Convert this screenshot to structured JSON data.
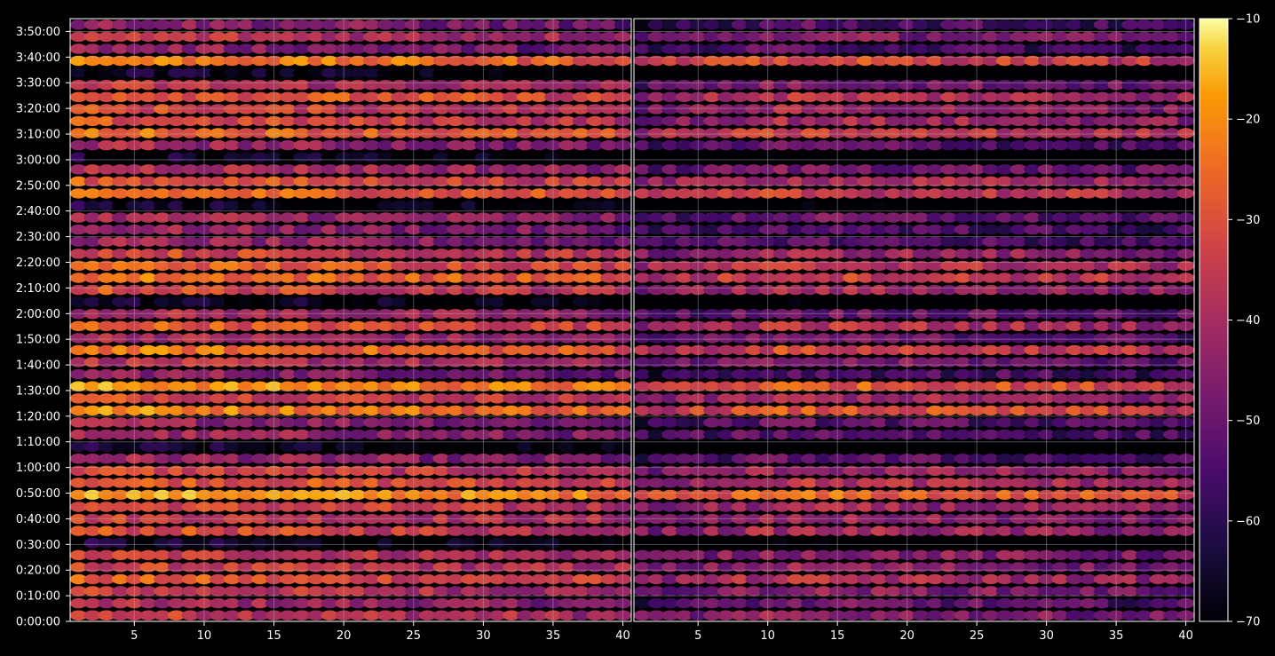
{
  "chart_data": [
    {
      "type": "heatmap",
      "title": "",
      "xlabel": "",
      "ylabel": "",
      "x_range": [
        1,
        40
      ],
      "y_range_seconds": [
        0,
        14100
      ],
      "x_ticks": [
        5,
        10,
        15,
        20,
        25,
        30,
        35,
        40
      ],
      "x_tick_labels": [
        "5",
        "10",
        "15",
        "20",
        "25",
        "30",
        "35",
        "40"
      ],
      "y_ticks_seconds": [
        0,
        600,
        1200,
        1800,
        2400,
        3000,
        3600,
        4200,
        4800,
        5400,
        6000,
        6600,
        7200,
        7800,
        8400,
        9000,
        9600,
        10200,
        10800,
        11400,
        12000,
        12600,
        13200,
        13800
      ],
      "y_tick_labels": [
        "0:00:00",
        "0:10:00",
        "0:20:00",
        "0:30:00",
        "0:40:00",
        "0:50:00",
        "1:00:00",
        "1:10:00",
        "1:20:00",
        "1:30:00",
        "1:40:00",
        "1:50:00",
        "2:00:00",
        "2:10:00",
        "2:20:00",
        "2:30:00",
        "2:40:00",
        "2:50:00",
        "3:00:00",
        "3:10:00",
        "3:20:00",
        "3:30:00",
        "3:40:00",
        "3:50:00"
      ],
      "grid": true,
      "colormap": "inferno",
      "value_scale": "higher values toward lower x; bright bands at 0:50, 1:20, 1:40, 2:10, 2:20, 2:50, 3:20, 3:40"
    },
    {
      "type": "heatmap",
      "title": "",
      "xlabel": "",
      "ylabel": "",
      "x_range": [
        1,
        40
      ],
      "y_range_seconds": [
        0,
        14100
      ],
      "x_ticks": [
        5,
        10,
        15,
        20,
        25,
        30,
        35,
        40
      ],
      "x_tick_labels": [
        "5",
        "10",
        "15",
        "20",
        "25",
        "30",
        "35",
        "40"
      ],
      "grid": true,
      "colormap": "inferno",
      "value_scale": "darker overall; low values near x=1-10"
    }
  ],
  "colorbar": {
    "min": -70,
    "max": -10,
    "ticks": [
      -70,
      -60,
      -50,
      -40,
      -30,
      -20,
      -10
    ],
    "tick_labels": [
      "−70",
      "−60",
      "−50",
      "−40",
      "−30",
      "−20",
      "−10"
    ]
  },
  "colors": {
    "background": "#000000",
    "axes": "#ffffff",
    "grid": "#b0b0b0"
  }
}
